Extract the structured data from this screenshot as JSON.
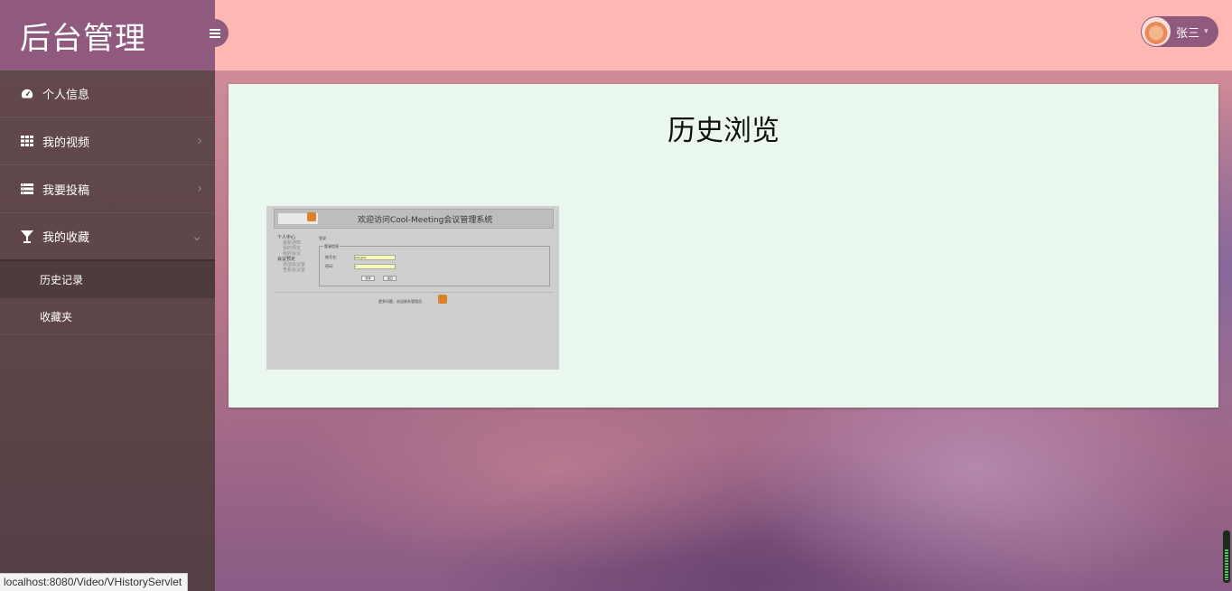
{
  "app": {
    "title": "后台管理"
  },
  "sidebar": {
    "items": [
      {
        "label": "个人信息",
        "icon": "dashboard-icon",
        "expandable": false
      },
      {
        "label": "我的视频",
        "icon": "grid-icon",
        "expandable": true
      },
      {
        "label": "我要投稿",
        "icon": "list-icon",
        "expandable": true
      },
      {
        "label": "我的收藏",
        "icon": "cocktail-glass-icon",
        "expandable": true,
        "expanded": true
      }
    ],
    "subitems": [
      {
        "label": "历史记录",
        "active": true
      },
      {
        "label": "收藏夹",
        "active": false
      }
    ]
  },
  "header": {
    "toggle_icon": "hamburger-menu-icon",
    "user_name": "张三",
    "user_caret": "▾"
  },
  "main": {
    "title": "历史浏览",
    "thumbnail": {
      "header_title": "欢迎访问Cool-Meeting会议管理系统",
      "side_links": [
        "个人中心",
        "最新通知",
        "我的预定",
        "我的会议",
        "会议预定",
        "添加会议室",
        "查看会议室"
      ],
      "breadcrumb": "登录",
      "form_legend": "登录信息",
      "username_label": "账号名:",
      "username_value": "wangshi",
      "password_label": "密码:",
      "password_value": "*",
      "login_button": "登录",
      "reset_button": "返回",
      "footer_text": "更多问题，欢迎联系管理员"
    }
  },
  "statusbar": {
    "url": "localhost:8080/Video/VHistoryServlet"
  },
  "colors": {
    "logo_bg": "#8f5a7e",
    "topbar_bg": "#feb8b3",
    "sidebar_bg": "#5c4447",
    "panel_bg": "#eaf7ef"
  }
}
